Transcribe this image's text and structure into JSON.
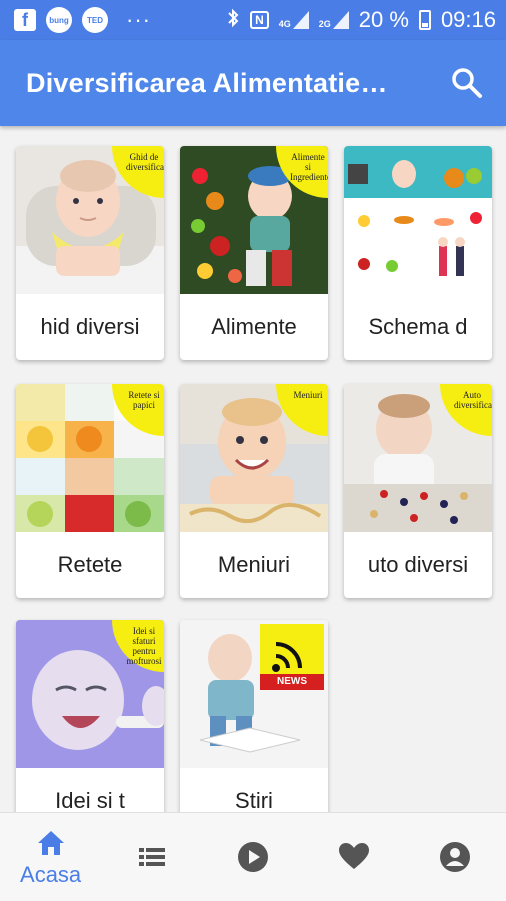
{
  "status_bar": {
    "battery_percent": "20 %",
    "time": "09:16",
    "fb_letter": "f",
    "badge1": "bung",
    "badge2": "TED",
    "dots": "···",
    "nfc": "N",
    "net1": "4G",
    "net2": "2G"
  },
  "app_bar": {
    "title": "Diversificarea Alimentatie…"
  },
  "cards": [
    {
      "label": "hid diversi",
      "tag": "Ghid de diversificare"
    },
    {
      "label": "Alimente",
      "tag": "Alimente si Ingrediente"
    },
    {
      "label": "Schema d",
      "tag": ""
    },
    {
      "label": "Retete",
      "tag": "Retete si papici"
    },
    {
      "label": "Meniuri",
      "tag": "Meniuri"
    },
    {
      "label": "uto diversi",
      "tag": "Auto diversificare"
    },
    {
      "label": "Idei si t",
      "tag": "Idei si sfaturi pentru mofturosi"
    },
    {
      "label": "Stiri",
      "tag": "NEWS"
    }
  ],
  "bottom_nav": {
    "home_label": "Acasa",
    "active_color": "#4a7ee6",
    "inactive_color": "#555555"
  },
  "colors": {
    "primary": "#4f86ea",
    "tag_yellow": "#f6ee10"
  }
}
